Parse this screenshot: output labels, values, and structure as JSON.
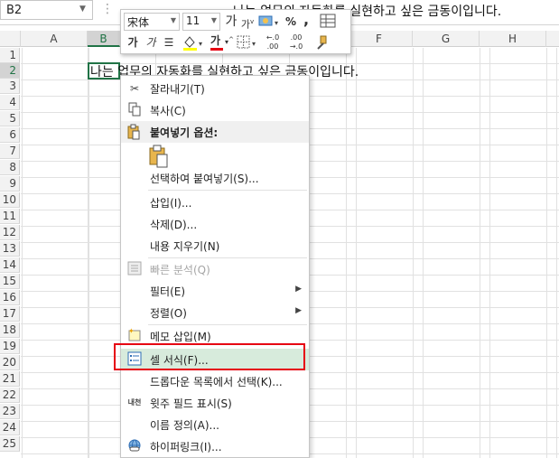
{
  "formula_bar": {
    "name_box": "B2",
    "formula": "나는 업무의 자동화를 실현하고 싶은 금동이입니다."
  },
  "columns": [
    "A",
    "B",
    "C",
    "D",
    "E",
    "F",
    "G",
    "H"
  ],
  "rows": [
    "1",
    "2",
    "3",
    "4",
    "5",
    "6",
    "7",
    "8",
    "9",
    "10",
    "11",
    "12",
    "13",
    "14",
    "15",
    "16",
    "17",
    "18",
    "19",
    "20",
    "21",
    "22",
    "23",
    "24",
    "25"
  ],
  "cell_b2": "나는 업무의 자동화를 실현하고 싶은 금동이입니다.",
  "mini_toolbar": {
    "font": "宋体",
    "size": "11",
    "grow_font": "가",
    "shrink_font": "가",
    "percent": "%",
    "comma": ",",
    "bold": "가",
    "italic": "가",
    "font_color_glyph": "가",
    "inc_decimal": "←.0 .00",
    "dec_decimal": ".00 →.0"
  },
  "context_menu": {
    "cut": "잘라내기(T)",
    "copy": "복사(C)",
    "paste_options": "붙여넣기 옵션:",
    "paste_special": "선택하여 붙여넣기(S)...",
    "insert": "삽입(I)...",
    "delete": "삭제(D)...",
    "clear_contents": "내용 지우기(N)",
    "quick_analysis": "빠른 분석(Q)",
    "filter": "필터(E)",
    "sort": "정렬(O)",
    "insert_comment": "메모 삽입(M)",
    "format_cells": "셀 서식(F)...",
    "pick_from_list": "드롭다운 목록에서 선택(K)...",
    "phonetic": "윗주 필드 표시(S)",
    "define_name": "이름 정의(A)...",
    "hyperlink": "하이퍼링크(I)...",
    "phonetic_icon": "내천"
  },
  "colors": {
    "accent": "#217346",
    "highlight": "#d7ebdc",
    "red_box": "#e60012"
  }
}
